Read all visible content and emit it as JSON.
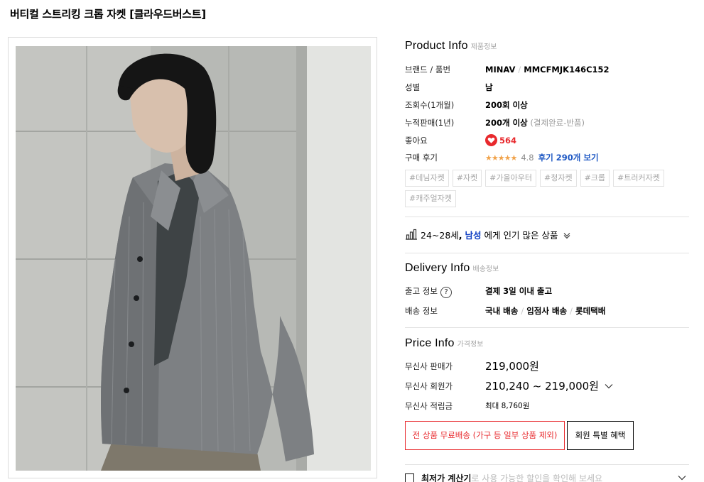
{
  "page_title": "버티컬 스트리킹 크롭 자켓 [클라우드버스트]",
  "product_info": {
    "title": "Product Info",
    "subtitle": "제품정보",
    "brand_label": "브랜드 / 품번",
    "brand": "MINAV",
    "product_code": "MMCFMJK146C152",
    "gender_label": "성별",
    "gender": "남",
    "views_label": "조회수(1개월)",
    "views": "200회 이상",
    "sales_label": "누적판매(1년)",
    "sales": "200개 이상",
    "sales_note": "(결제완료-반품)",
    "likes_label": "좋아요",
    "likes": "564",
    "reviews_label": "구매 후기",
    "stars": "★★★★★",
    "rating": "4.8",
    "review_link": "후기 290개 보기",
    "tags": [
      "#데님자켓",
      "#자켓",
      "#가을아우터",
      "#청자켓",
      "#크롭",
      "#트러커자켓",
      "#캐주얼자켓"
    ]
  },
  "popular": {
    "age": "24~28세",
    "comma": ",",
    "gender": "남성",
    "text": "에게 인기 많은 상품"
  },
  "delivery_info": {
    "title": "Delivery Info",
    "subtitle": "배송정보",
    "ship_label": "출고 정보",
    "help": "?",
    "ship_value": "결제 3일 이내 출고",
    "method_label": "배송 정보",
    "method_1": "국내 배송",
    "method_2": "입점사 배송",
    "method_3": "롯데택배"
  },
  "price_info": {
    "title": "Price Info",
    "subtitle": "가격정보",
    "sale_label": "무신사 판매가",
    "sale_price": "219,000원",
    "member_label": "무신사 회원가",
    "member_price": "210,240 ~ 219,000원",
    "points_label": "무신사 적립금",
    "points": "최대 8,760원",
    "free_shipping_button": "전 상품 무료배송 (가구 등 일부 상품 제외)",
    "member_benefit_button": "회원 특별 혜택"
  },
  "bottom": {
    "strong": "최저가 계산기",
    "rest": "로 사용 가능한 할인을 확인해 보세요"
  },
  "colors": {
    "accent_red": "#e8292d",
    "link_blue": "#1e58c4",
    "popular_blue": "#0e3ec3",
    "star_orange": "#f1a34b"
  }
}
